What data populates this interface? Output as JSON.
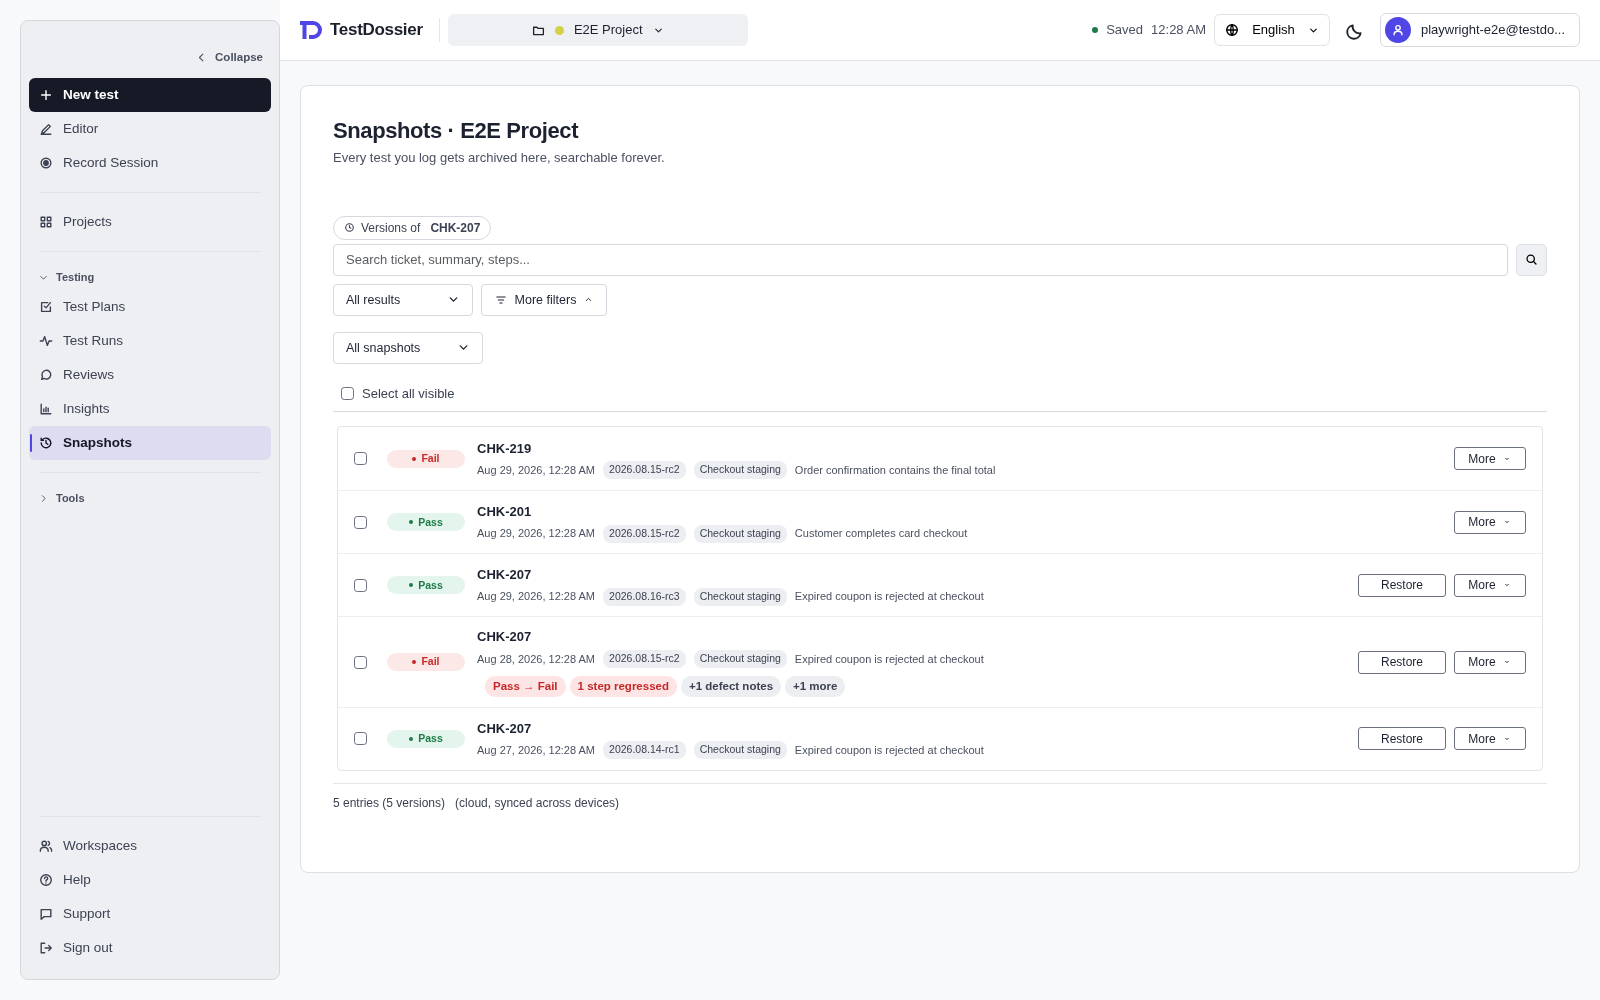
{
  "sidebar": {
    "collapse": "Collapse",
    "groups": [
      {
        "items": [
          {
            "label": "New test",
            "kind": "primary",
            "selected": false
          },
          {
            "label": "Editor",
            "kind": "link",
            "selected": false
          },
          {
            "label": "Record Session",
            "kind": "link",
            "selected": false
          }
        ]
      },
      {
        "items": [
          {
            "label": "Projects",
            "kind": "link",
            "selected": false
          }
        ]
      },
      {
        "title": "Testing",
        "expanded": true,
        "items": [
          {
            "label": "Test Plans",
            "kind": "link",
            "selected": false
          },
          {
            "label": "Test Runs",
            "kind": "link",
            "selected": false
          },
          {
            "label": "Reviews",
            "kind": "link",
            "selected": false
          },
          {
            "label": "Insights",
            "kind": "link",
            "selected": false
          },
          {
            "label": "Snapshots",
            "kind": "link",
            "selected": true
          }
        ]
      },
      {
        "title": "Tools",
        "expanded": false
      }
    ],
    "bottom": [
      {
        "label": "Workspaces"
      },
      {
        "label": "Help"
      },
      {
        "label": "Support"
      },
      {
        "label": "Sign out"
      }
    ]
  },
  "header": {
    "brand": "TestDossier",
    "project": {
      "name": "E2E Project",
      "color": "#d3d145"
    },
    "status": "Saved",
    "time": "12:28 AM",
    "language": "English",
    "user": "playwright-e2e@testdo..."
  },
  "page": {
    "title": "Snapshots · E2E Project",
    "subtitle": "Every test you log gets archived here, searchable forever.",
    "version_filter": {
      "label": "Versions of",
      "value": "CHK-207"
    },
    "search": {
      "placeholder": "Search ticket, summary, steps..."
    },
    "result_filter": "All results",
    "more_filters": {
      "label": "More filters",
      "expanded": true
    },
    "snapshot_filter": "All snapshots",
    "select_all": {
      "label": "Select all visible",
      "checked": false
    },
    "rows": [
      {
        "checked": false,
        "result": {
          "kind": "fail",
          "label": "Fail"
        },
        "ticket": "CHK-219",
        "date": "Aug 29, 2026, 12:28 AM",
        "build": "2026.08.15-rc2",
        "env": "Checkout staging",
        "summary": "Order confirmation contains the final total",
        "tags": [],
        "actions": [
          "More"
        ]
      },
      {
        "checked": false,
        "result": {
          "kind": "pass",
          "label": "Pass"
        },
        "ticket": "CHK-201",
        "date": "Aug 29, 2026, 12:28 AM",
        "build": "2026.08.15-rc2",
        "env": "Checkout staging",
        "summary": "Customer completes card checkout",
        "tags": [],
        "actions": [
          "More"
        ]
      },
      {
        "checked": false,
        "result": {
          "kind": "pass",
          "label": "Pass"
        },
        "ticket": "CHK-207",
        "date": "Aug 29, 2026, 12:28 AM",
        "build": "2026.08.16-rc3",
        "env": "Checkout staging",
        "summary": "Expired coupon is rejected at checkout",
        "tags": [],
        "actions": [
          "Restore",
          "More"
        ]
      },
      {
        "checked": false,
        "result": {
          "kind": "fail",
          "label": "Fail"
        },
        "ticket": "CHK-207",
        "date": "Aug 28, 2026, 12:28 AM",
        "build": "2026.08.15-rc2",
        "env": "Checkout staging",
        "summary": "Expired coupon is rejected at checkout",
        "tags": [
          {
            "text": "Pass → Fail",
            "kind": "danger"
          },
          {
            "text": "1 step regressed",
            "kind": "danger"
          },
          {
            "text": "+1 defect notes",
            "kind": "neutral"
          },
          {
            "text": "+1 more",
            "kind": "neutral"
          }
        ],
        "actions": [
          "Restore",
          "More"
        ]
      },
      {
        "checked": false,
        "result": {
          "kind": "pass",
          "label": "Pass"
        },
        "ticket": "CHK-207",
        "date": "Aug 27, 2026, 12:28 AM",
        "build": "2026.08.14-rc1",
        "env": "Checkout staging",
        "summary": "Expired coupon is rejected at checkout",
        "tags": [],
        "actions": [
          "Restore",
          "More"
        ]
      }
    ],
    "footer": {
      "count": "5 entries (5 versions)",
      "note": "(cloud, synced across devices)"
    }
  }
}
